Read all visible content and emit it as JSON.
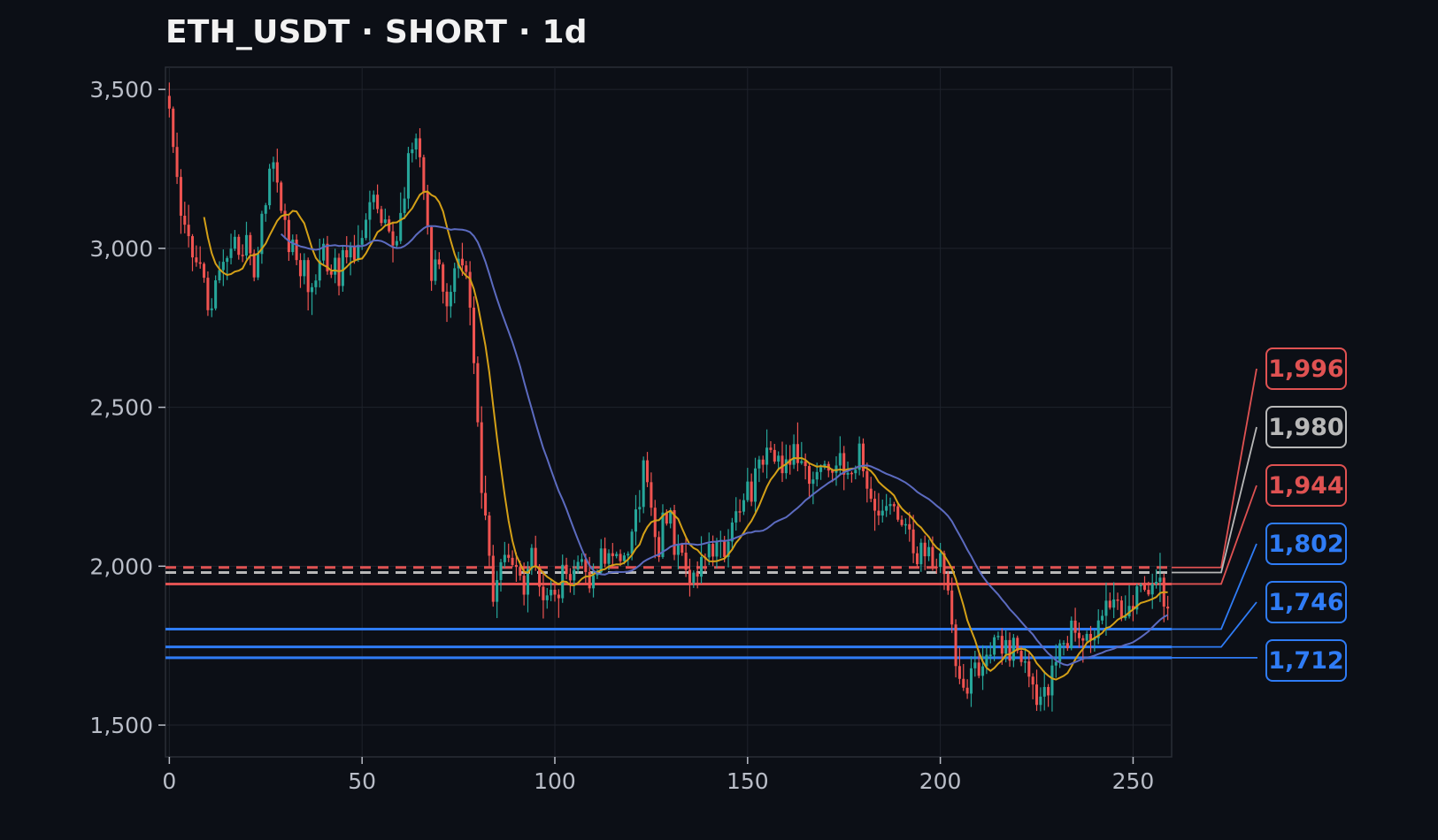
{
  "chart_data": {
    "type": "candlestick",
    "title": "ETH_USDT · SHORT · 1d",
    "xlabel": "",
    "ylabel": "",
    "xlim": [
      -1,
      260
    ],
    "ylim": [
      1400,
      3570
    ],
    "x_ticks": [
      0,
      50,
      100,
      150,
      200,
      250
    ],
    "y_ticks": [
      1500,
      2000,
      2500,
      3000,
      3500
    ],
    "x_tick_labels": [
      "0",
      "50",
      "100",
      "150",
      "200",
      "250"
    ],
    "y_tick_labels": [
      "1,500",
      "2,000",
      "2,500",
      "3,000",
      "3,500"
    ],
    "grid": true,
    "colors": {
      "background": "#0c0f16",
      "up": "#26a69a",
      "down": "#ef5350",
      "ma_fast": "#d4a017",
      "ma_slow": "#5c6bc0",
      "grid": "#1f232c",
      "level_red": "#e05252",
      "level_gray": "#b8b8b8",
      "level_blue": "#2f7cf6"
    },
    "anchor_closes": [
      [
        0,
        3410
      ],
      [
        3,
        3120
      ],
      [
        6,
        3020
      ],
      [
        8,
        2900
      ],
      [
        10,
        2780
      ],
      [
        13,
        2950
      ],
      [
        16,
        3010
      ],
      [
        18,
        2970
      ],
      [
        20,
        3050
      ],
      [
        22,
        2860
      ],
      [
        24,
        3100
      ],
      [
        26,
        3250
      ],
      [
        28,
        3180
      ],
      [
        30,
        3050
      ],
      [
        33,
        2960
      ],
      [
        36,
        2890
      ],
      [
        40,
        2960
      ],
      [
        44,
        2920
      ],
      [
        47,
        2990
      ],
      [
        50,
        3020
      ],
      [
        53,
        3160
      ],
      [
        55,
        3090
      ],
      [
        58,
        3000
      ],
      [
        60,
        3110
      ],
      [
        62,
        3270
      ],
      [
        64,
        3330
      ],
      [
        66,
        3220
      ],
      [
        68,
        2960
      ],
      [
        70,
        2930
      ],
      [
        72,
        2840
      ],
      [
        74,
        2950
      ],
      [
        76,
        3000
      ],
      [
        78,
        2850
      ],
      [
        80,
        2420
      ],
      [
        82,
        2140
      ],
      [
        84,
        1900
      ],
      [
        86,
        2020
      ],
      [
        88,
        2030
      ],
      [
        91,
        1950
      ],
      [
        94,
        2030
      ],
      [
        97,
        1920
      ],
      [
        100,
        1910
      ],
      [
        103,
        1960
      ],
      [
        106,
        2020
      ],
      [
        109,
        1960
      ],
      [
        112,
        2000
      ],
      [
        115,
        2040
      ],
      [
        118,
        2070
      ],
      [
        121,
        2130
      ],
      [
        123,
        2340
      ],
      [
        125,
        2200
      ],
      [
        127,
        2100
      ],
      [
        130,
        2130
      ],
      [
        133,
        2030
      ],
      [
        136,
        2010
      ],
      [
        139,
        2070
      ],
      [
        142,
        2040
      ],
      [
        145,
        2090
      ],
      [
        148,
        2170
      ],
      [
        150,
        2230
      ],
      [
        153,
        2330
      ],
      [
        156,
        2380
      ],
      [
        159,
        2300
      ],
      [
        162,
        2330
      ],
      [
        165,
        2290
      ],
      [
        168,
        2280
      ],
      [
        171,
        2310
      ],
      [
        174,
        2320
      ],
      [
        177,
        2300
      ],
      [
        179,
        2340
      ],
      [
        181,
        2250
      ],
      [
        184,
        2190
      ],
      [
        187,
        2150
      ],
      [
        190,
        2120
      ],
      [
        193,
        2080
      ],
      [
        196,
        2040
      ],
      [
        198,
        2020
      ],
      [
        200,
        1990
      ],
      [
        202,
        1900
      ],
      [
        204,
        1640
      ],
      [
        206,
        1580
      ],
      [
        208,
        1650
      ],
      [
        211,
        1660
      ],
      [
        213,
        1720
      ],
      [
        215,
        1760
      ],
      [
        217,
        1750
      ],
      [
        220,
        1720
      ],
      [
        222,
        1680
      ],
      [
        225,
        1590
      ],
      [
        228,
        1600
      ],
      [
        230,
        1720
      ],
      [
        232,
        1780
      ],
      [
        235,
        1770
      ],
      [
        238,
        1760
      ],
      [
        241,
        1800
      ],
      [
        244,
        1870
      ],
      [
        247,
        1880
      ],
      [
        250,
        1890
      ],
      [
        253,
        1920
      ],
      [
        256,
        1940
      ],
      [
        259,
        1910
      ]
    ],
    "volatility": 42,
    "series": [
      {
        "name": "",
        "kind": "moving-average",
        "period": 10,
        "color": "#d4a017"
      },
      {
        "name": "",
        "kind": "moving-average",
        "period": 30,
        "color": "#5c6bc0"
      }
    ],
    "levels": [
      {
        "label": "1,996",
        "value": 1996,
        "style": "dashed",
        "color": "#e05252",
        "border": "#e05252"
      },
      {
        "label": "1,980",
        "value": 1980,
        "style": "dashed",
        "color": "#b8b8b8",
        "border": "#b8b8b8"
      },
      {
        "label": "1,944",
        "value": 1944,
        "style": "solid",
        "color": "#e05252",
        "border": "#e05252"
      },
      {
        "label": "1,802",
        "value": 1802,
        "style": "solid",
        "color": "#2f7cf6",
        "border": "#2f7cf6"
      },
      {
        "label": "1,746",
        "value": 1746,
        "style": "solid",
        "color": "#2f7cf6",
        "border": "#2f7cf6"
      },
      {
        "label": "1,712",
        "value": 1712,
        "style": "solid",
        "color": "#2f7cf6",
        "border": "#2f7cf6"
      }
    ]
  }
}
